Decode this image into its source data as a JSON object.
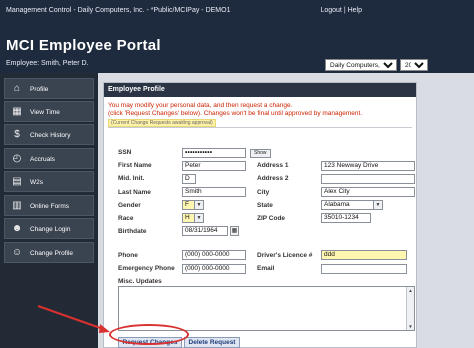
{
  "topbar": {
    "breadcrumb": "Management Control - Daily Computers, Inc. - *Public/MCIPay - DEMO1",
    "logout": "Logout",
    "separator": "|",
    "help": "Help"
  },
  "header": {
    "title": "MCI Employee Portal",
    "employee": "Employee: Smith, Peter D.",
    "company_select": "Daily Computers, Inc.",
    "year_select": "2014"
  },
  "sidebar": {
    "items": [
      {
        "label": "Profile",
        "icon": "home-icon"
      },
      {
        "label": "View Time",
        "icon": "calendar-icon"
      },
      {
        "label": "Check History",
        "icon": "money-bag-icon"
      },
      {
        "label": "Accruals",
        "icon": "clock-icon"
      },
      {
        "label": "W2s",
        "icon": "document-icon"
      },
      {
        "label": "Online Forms",
        "icon": "forms-icon"
      },
      {
        "label": "Change Login",
        "icon": "user-icon"
      },
      {
        "label": "Change Profile",
        "icon": "user-settings-icon"
      }
    ]
  },
  "profile": {
    "heading": "Employee Profile",
    "message_line1": "You may modify your personal data, and then request a change.",
    "message_line2": "(click 'Request Changes' below). Changes won't be final until approved by management.",
    "pending_note": "(Current Change Requests awaiting approval)",
    "labels": {
      "ssn": "SSN",
      "first_name": "First Name",
      "mid_init": "Mid. Init.",
      "last_name": "Last Name",
      "gender": "Gender",
      "race": "Race",
      "birthdate": "Birthdate",
      "address1": "Address 1",
      "address2": "Address 2",
      "city": "City",
      "state": "State",
      "zip": "ZIP Code",
      "phone": "Phone",
      "emergency_phone": "Emergency Phone",
      "drivers_licence": "Driver's Licence #",
      "email": "Email",
      "misc_updates": "Misc. Updates"
    },
    "values": {
      "ssn": "•••••••••••",
      "first_name": "Peter",
      "mid_init": "D",
      "last_name": "Smith",
      "gender": "F",
      "race": "H",
      "birthdate": "08/31/1964",
      "address1": "123 Newway Drive",
      "address2": "",
      "city": "Alex City",
      "state": "Alabama",
      "zip": "35010-1234",
      "phone": "(000) 000-0000",
      "emergency_phone": "(000) 000-0000",
      "drivers_licence": "ddd",
      "email": ""
    },
    "show_button": "Show",
    "request_button": "Request Changes",
    "delete_button": "Delete Request"
  },
  "colors": {
    "header_bg": "#1e2a3e",
    "sidebar_bg": "#222a36",
    "message_red": "#cc2200",
    "highlight_yellow": "#fff7b0",
    "annotation_red": "#d8312f"
  }
}
